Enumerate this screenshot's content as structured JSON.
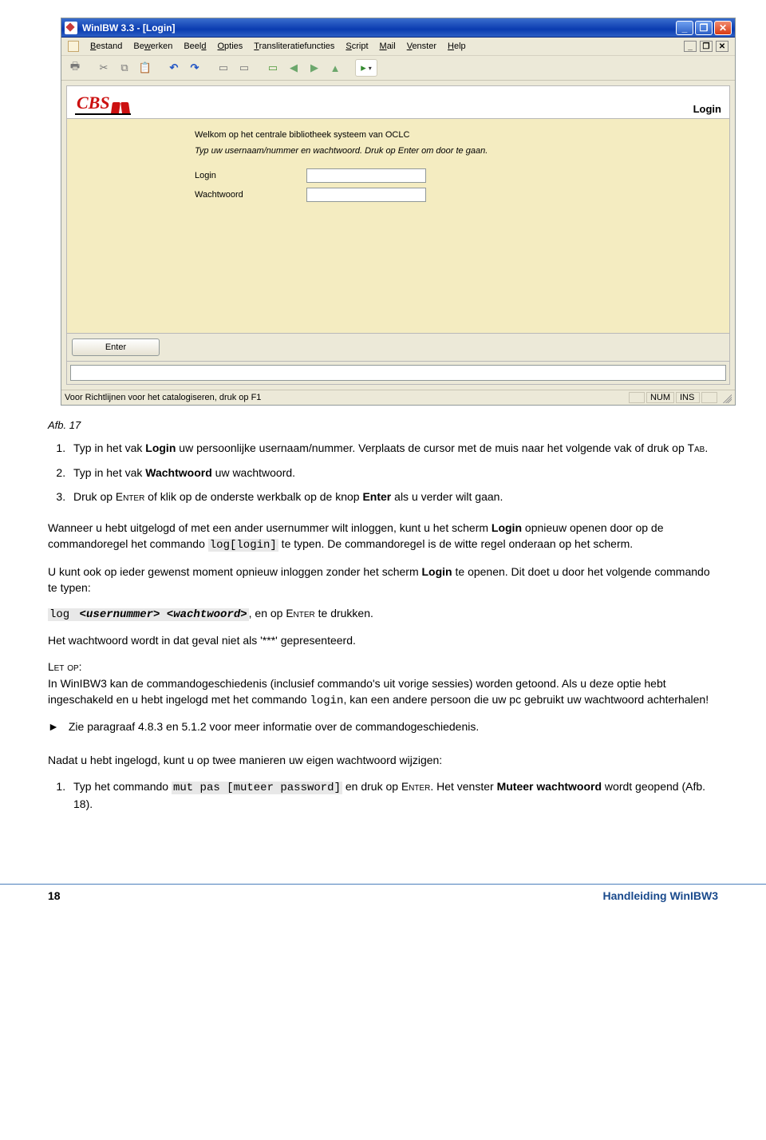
{
  "app": {
    "title": "WinIBW 3.3 - [Login]",
    "menus": [
      "Bestand",
      "Bewerken",
      "Beeld",
      "Opties",
      "Transliteratiefuncties",
      "Script",
      "Mail",
      "Venster",
      "Help"
    ],
    "login_header": "Login",
    "welcome": "Welkom op het centrale bibliotheek systeem van OCLC",
    "instruction": "Typ uw usernaam/nummer en wachtwoord. Druk op Enter om door te gaan.",
    "login_label": "Login",
    "password_label": "Wachtwoord",
    "enter_button": "Enter",
    "status_hint": "Voor Richtlijnen voor het catalogiseren, druk op F1",
    "status_num": "NUM",
    "status_ins": "INS",
    "logo": "CBS"
  },
  "doc": {
    "fig_caption": "Afb. 17",
    "step1_a": "Typ in het vak ",
    "step1_b": "Login",
    "step1_c": " uw persoonlijke usernaam/nummer. Verplaats de cursor met de muis naar het volgende vak of druk op ",
    "step1_tab": "Tab",
    "step1_d": ".",
    "step2_a": "Typ in het vak ",
    "step2_b": "Wachtwoord",
    "step2_c": " uw wachtwoord.",
    "step3_a": "Druk op ",
    "step3_enter": "Enter",
    "step3_b": " of klik op de onderste werkbalk op de knop ",
    "step3_btn": "Enter",
    "step3_c": " als u verder wilt gaan.",
    "p1_a": "Wanneer u hebt uitgelogd of met een ander usernummer wilt inloggen, kunt u het scherm ",
    "p1_login": "Login",
    "p1_b": " opnieuw openen door op de commandoregel het commando ",
    "p1_cmd": "log[login]",
    "p1_c": " te typen. De commandoregel is de witte regel onderaan op het scherm.",
    "p2_a": "U kunt ook op ieder gewenst moment opnieuw inloggen zonder het scherm ",
    "p2_login": "Login",
    "p2_b": " te openen. Dit doet u door het volgende commando te typen:",
    "cmdline_a": "log ",
    "cmdline_b": "<usernummer> <wachtwoord>",
    "cmdline_c": ", en op ",
    "cmdline_enter": "Enter",
    "cmdline_d": " te drukken.",
    "p3": "Het wachtwoord wordt in dat geval niet als '***' gepresenteerd.",
    "letop": "Let op",
    "p4_a": ":",
    "p4_b": "In WinIBW3 kan de commandogeschiedenis (inclusief commando's uit vorige sessies) worden getoond. Als u deze optie hebt ingeschakeld en u hebt ingelogd met het commando ",
    "p4_cmd": "login",
    "p4_c": ", kan een andere persoon die uw pc gebruikt uw wachtwoord achterhalen!",
    "bullet": "Zie paragraaf 4.8.3 en 5.1.2 voor meer informatie over de commandogeschiedenis.",
    "p5": "Nadat u hebt ingelogd, kunt u op twee manieren uw eigen wachtwoord wijzigen:",
    "s1_a": "Typ het commando ",
    "s1_cmd": "mut pas [muteer password]",
    "s1_b": " en druk op ",
    "s1_enter": "Enter",
    "s1_c": ". Het venster ",
    "s1_win": "Muteer wachtwoord",
    "s1_d": " wordt geopend (Afb. 18).",
    "page_number": "18",
    "brand": "Handleiding WinIBW3"
  }
}
